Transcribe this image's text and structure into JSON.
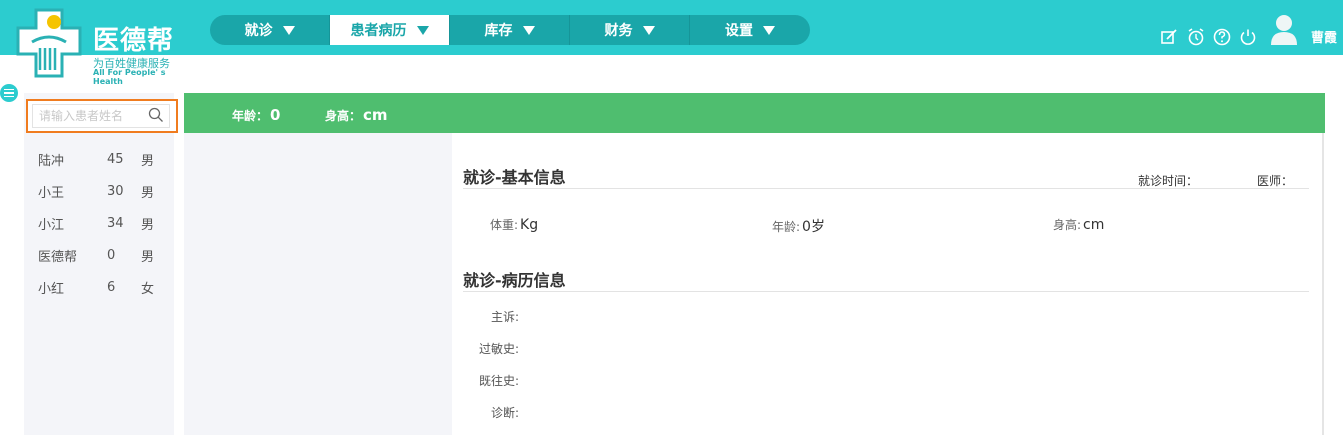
{
  "app": {
    "name": "医德帮",
    "tagline": "为百姓健康服务",
    "tagline_en": "All For People' s Health"
  },
  "nav": {
    "items": [
      {
        "label": "就诊"
      },
      {
        "label": "患者病历",
        "active": true
      },
      {
        "label": "库存"
      },
      {
        "label": "财务"
      },
      {
        "label": "设置"
      }
    ]
  },
  "header_tools": {
    "icons": [
      "edit-icon",
      "alarm-icon",
      "help-icon",
      "power-icon"
    ],
    "user_name": "曹霞"
  },
  "sidebar": {
    "search_placeholder": "请输入患者姓名",
    "patients": [
      {
        "name": "陆冲",
        "age": "45",
        "sex": "男"
      },
      {
        "name": "小王",
        "age": "30",
        "sex": "男"
      },
      {
        "name": "小江",
        "age": "34",
        "sex": "男"
      },
      {
        "name": "医德帮",
        "age": "0",
        "sex": "男"
      },
      {
        "name": "小红",
        "age": "6",
        "sex": "女"
      }
    ]
  },
  "info_bar": {
    "age_label": "年龄：",
    "age_value": "0",
    "height_label": "身高：",
    "height_value": "cm"
  },
  "basic_info": {
    "title": "就诊-基本信息",
    "visit_time_label": "就诊时间：",
    "doctor_label": "医师：",
    "weight_label": "体重:",
    "weight_value": "Kg",
    "age_label": "年龄:",
    "age_value": "0岁",
    "height_label": "身高:",
    "height_value": "cm"
  },
  "record_info": {
    "title": "就诊-病历信息",
    "fields": [
      {
        "label": "主诉:"
      },
      {
        "label": "过敏史:"
      },
      {
        "label": "既往史:"
      },
      {
        "label": "诊断:"
      }
    ]
  },
  "colors": {
    "header": "#2ccccf",
    "nav": "#1aa6a9",
    "info_bar": "#4fbe6f",
    "search_focus": "#f07c1f"
  }
}
